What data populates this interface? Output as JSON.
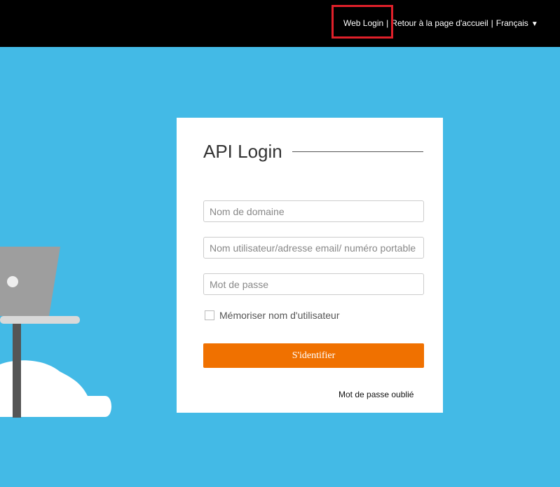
{
  "topbar": {
    "web_login": "Web Login",
    "separator": "|",
    "back_home": "Retour à la page d'accueil",
    "language": "Français",
    "language_arrow": "▼"
  },
  "login": {
    "title": "API Login",
    "domain_placeholder": "Nom de domaine",
    "username_placeholder": "Nom utilisateur/adresse email/ numéro portable",
    "password_placeholder": "Mot de passe",
    "remember_label": "Mémoriser nom d'utilisateur",
    "submit_label": "S'identifier",
    "forgot_label": "Mot de passe oublié"
  },
  "colors": {
    "background": "#43bae6",
    "topbar": "#000000",
    "primary_button": "#f07100",
    "highlight_box": "#e0202a"
  }
}
